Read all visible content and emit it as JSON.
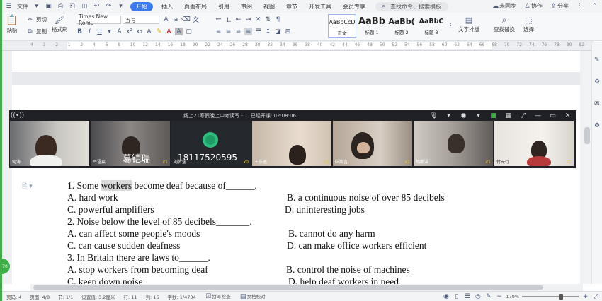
{
  "menubar": {
    "file_label": "文件",
    "tabs": [
      {
        "label": "开始",
        "active": true
      },
      {
        "label": "插入"
      },
      {
        "label": "页面布局"
      },
      {
        "label": "引用"
      },
      {
        "label": "审阅"
      },
      {
        "label": "视图"
      },
      {
        "label": "章节"
      },
      {
        "label": "开发工具"
      },
      {
        "label": "会员专享"
      }
    ],
    "search_placeholder": "查找命令、搜索模板",
    "sync_label": "未同步",
    "collab_label": "协作",
    "share_label": "分享"
  },
  "ribbon": {
    "paste": "粘贴",
    "cut": "剪切",
    "copy": "复制",
    "format_painter": "格式刷",
    "font_name": "Times New Romu",
    "font_size": "五号",
    "styles": [
      {
        "sample": "AaBbCcD",
        "label": "正文"
      },
      {
        "sample": "AaBb",
        "label": "标题 1"
      },
      {
        "sample": "AaBb(",
        "label": "标题 2"
      },
      {
        "sample": "AaBbC",
        "label": "标题 3"
      }
    ],
    "text_layout": "文字排版",
    "find_replace": "查找替换",
    "select": "选择"
  },
  "ruler": {
    "marks": [
      "4",
      "3",
      "2",
      "1",
      "2",
      "4",
      "6",
      "8",
      "10",
      "12",
      "14",
      "16",
      "18",
      "20",
      "22",
      "24",
      "26",
      "28",
      "30",
      "32",
      "34",
      "36",
      "38",
      "40",
      "42",
      "44",
      "46",
      "48",
      "50",
      "52",
      "54",
      "56",
      "58",
      "60",
      "62",
      "64",
      "66",
      "68",
      "70",
      "72",
      "74",
      "76",
      "78",
      "80",
      "82"
    ]
  },
  "video": {
    "title": "线上21寒假晚上中考读写 - 1",
    "timer_label": "已经开课: 02:08:06",
    "participants": [
      {
        "name": "何涛",
        "stat": ""
      },
      {
        "name": "严语宸",
        "stat": "x1"
      },
      {
        "name": "刘梦涵",
        "stat": "x0"
      },
      {
        "name": "王乐遥",
        "stat": "x1"
      },
      {
        "name": "陆斯言",
        "stat": "x1"
      },
      {
        "name": "胡斯洋",
        "stat": "x1"
      },
      {
        "name": "付元行",
        "stat": "x1"
      }
    ],
    "overlay_name": "葛铠瑞",
    "overlay_phone": "18117520595"
  },
  "questions": {
    "q1_pre": "1. Some ",
    "q1_hl": "workers",
    "q1_post": " become deaf because of______.",
    "q1_a": "A. hard work",
    "q1_b": "B. a continuous noise of over 85 decibels",
    "q1_c": "C. powerful amplifiers",
    "q1_d": "D. uninteresting jobs",
    "q2": "2. Noise below the level of 85 decibels_______.",
    "q2_a": "A. can affect some people's moods",
    "q2_b": "B. cannot do any harm",
    "q2_c": "C. can cause sudden deafness",
    "q2_d": "D. can make office workers efficient",
    "q3": "3. In Britain there are laws to______.",
    "q3_a": "A. stop workers from becoming deaf",
    "q3_b": "B. control the noise of machines",
    "q3_c": "C. keep down noise",
    "q3_d": "D. help deaf workers in need"
  },
  "status": {
    "page_count": "页码: 4",
    "pages": "页面: 4/8",
    "section": "节: 1/1",
    "setting": "设置值: 3.2厘米",
    "row": "行: 11",
    "col": "列: 16",
    "words": "字数: 1/4734",
    "spell": "拼写检查",
    "doc_check": "文档校对",
    "zoom": "170%",
    "side_badge": "70"
  }
}
